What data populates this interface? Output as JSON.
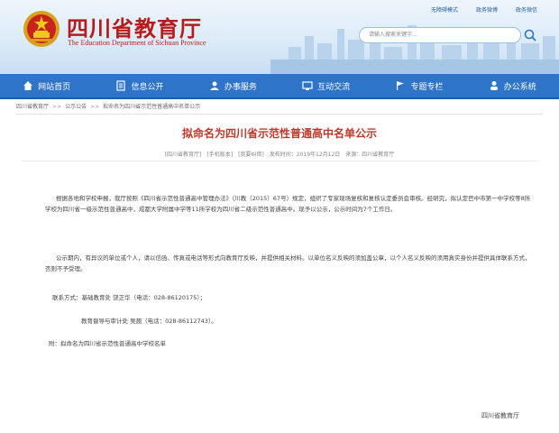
{
  "header": {
    "site_title": "四川省教育厅",
    "site_subtitle": "The Education Department of Sichuan Province",
    "top_links": [
      "无障碍模式",
      "政务微博",
      "政务微信"
    ],
    "search_placeholder": "请输入搜索关键字..."
  },
  "nav": {
    "items": [
      {
        "label": "网站首页",
        "icon": "home-icon"
      },
      {
        "label": "信息公开",
        "icon": "document-icon"
      },
      {
        "label": "办事服务",
        "icon": "service-icon"
      },
      {
        "label": "互动交流",
        "icon": "monitor-icon"
      },
      {
        "label": "专题专栏",
        "icon": "flag-icon"
      },
      {
        "label": "办公系统",
        "icon": "user-icon"
      }
    ]
  },
  "breadcrumb": [
    "四川省教育厅",
    "公示公告",
    "拟命名为四川省示范性普通高中名单公示"
  ],
  "article": {
    "title": "拟命名为四川省示范性普通高中名单公示",
    "meta": [
      "[四川省教育厅]",
      "[手机版本]",
      "[我要纠错]",
      "发布时间：2019年12月12日",
      "来源：四川省教育厅"
    ],
    "paragraph1": "根据各地和学校申报，我厅按照《四川省示范性普通高中管理办法》（川教〔2015〕67号）规定，组织了专家现场复核和复核认定委员会审核。经研究，拟认定巴中市第一中学校等8所学校为四川省一级示范性普通高中，成都大学附属中学等11所学校为四川省二级示范性普通高中。现予以公示，公示时间为7个工作日。",
    "paragraph2": "公示期内，有异议的单位或个人，请以信函、传真或电话等形式向教育厅反映，并提供相关材料。以单位名义反映的须加盖公章，以个人名义反映的须用真实身份并提供具体联系方式，否则不予受理。",
    "contact1": "联系方式：基础教育处   饶正华（电话：028-86120175）；",
    "contact2": "教育督导与审计处   吴翘（电话：028-86112743）。",
    "attachment": "附：拟命名为四川省示范性普通高中学校名单",
    "signature": "四川省教育厅"
  },
  "colors": {
    "brand_red": "#b51c1c",
    "nav_blue": "#2e74c8",
    "title_red": "#c0392b"
  }
}
